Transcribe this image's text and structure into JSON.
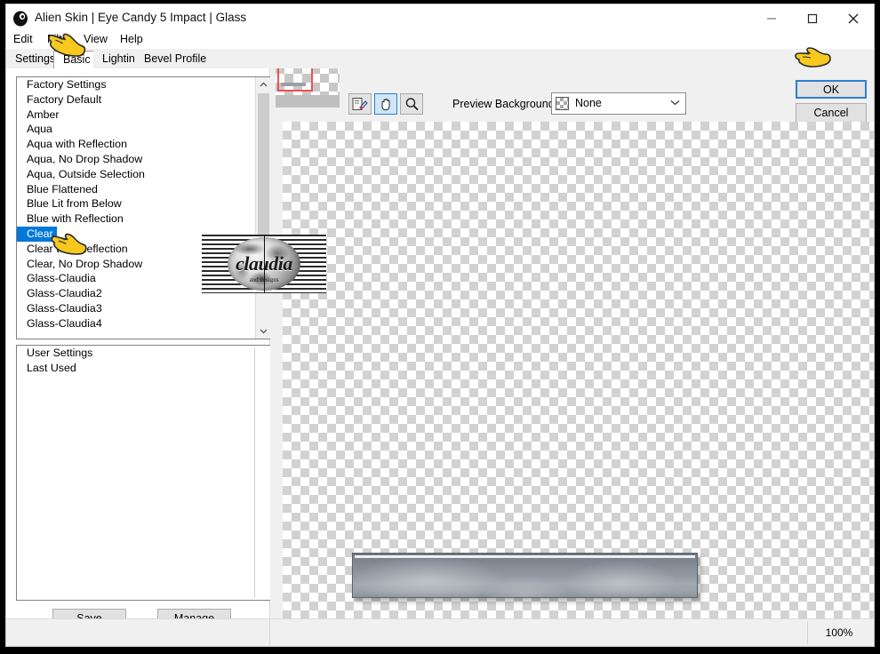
{
  "window": {
    "title": "Alien Skin | Eye Candy 5 Impact | Glass",
    "app_icon": "alien-skin-icon",
    "controls": {
      "minimize": "–",
      "maximize": "☐",
      "close": "✕"
    }
  },
  "menu": {
    "items": [
      {
        "label": "Edit"
      },
      {
        "label": "Filter"
      },
      {
        "label": "View"
      },
      {
        "label": "Help"
      }
    ]
  },
  "tabs": [
    {
      "label": "Settings",
      "active": true
    },
    {
      "label": "Basic",
      "active": false
    },
    {
      "label": "Lighting",
      "active": false
    },
    {
      "label": "Bevel Profile",
      "active": false
    }
  ],
  "settings_panel": {
    "factory_list": {
      "items": [
        "Factory Settings",
        "Factory Default",
        "Amber",
        "Aqua",
        "Aqua with Reflection",
        "Aqua, No Drop Shadow",
        "Aqua, Outside Selection",
        "Blue Flattened",
        "Blue Lit from Below",
        "Blue with Reflection",
        "Clear",
        "Clear with Reflection",
        "Clear, No Drop Shadow",
        "Glass-Claudia",
        "Glass-Claudia2",
        "Glass-Claudia3",
        "Glass-Claudia4"
      ],
      "selected": "Clear",
      "selected_index": 10
    },
    "user_list": {
      "items": [
        "User Settings",
        "Last Used"
      ]
    },
    "buttons": {
      "save": "Save",
      "manage": "Manage"
    }
  },
  "toolbar": {
    "tools": [
      {
        "name": "eyedropper-tool",
        "active": false
      },
      {
        "name": "hand-tool",
        "active": true
      },
      {
        "name": "zoom-tool",
        "active": false
      }
    ],
    "preview_background": {
      "label": "Preview Background:",
      "value": "None",
      "swatch": "transparent-checker",
      "caret": "⌄"
    }
  },
  "actions": {
    "ok": "OK",
    "cancel": "Cancel"
  },
  "status": {
    "zoom_level": "100%"
  },
  "watermark": {
    "text": "claudia",
    "subtext": "and designs"
  },
  "colors": {
    "accent": "#0078d7",
    "selection_border": "#2d7fd3",
    "nav_selection": "#f05050",
    "button_face": "#e1e1e1",
    "panel": "#f0f0f0",
    "glass_body": "#8f959f"
  }
}
